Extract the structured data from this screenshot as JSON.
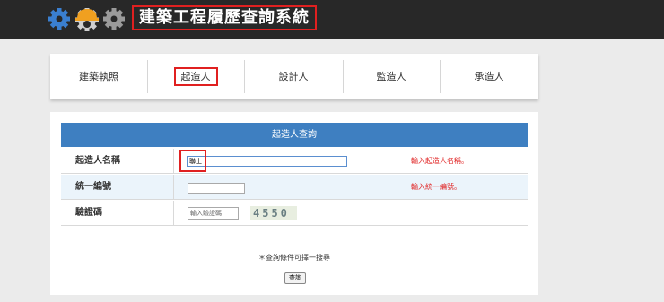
{
  "header": {
    "title": "建築工程履歷查詢系統",
    "logo_icons": [
      "gear-icon",
      "hardhat-gear-icon",
      "gear-icon"
    ]
  },
  "tabs": [
    {
      "label": "建築執照",
      "active": false
    },
    {
      "label": "起造人",
      "active": true
    },
    {
      "label": "設計人",
      "active": false
    },
    {
      "label": "監造人",
      "active": false
    },
    {
      "label": "承造人",
      "active": false
    }
  ],
  "panel": {
    "title": "起造人查詢",
    "rows": [
      {
        "label": "起造人名稱",
        "value": "聯上",
        "hint": "輸入起造人名稱。"
      },
      {
        "label": "統一編號",
        "value": "",
        "hint": "輸入統一編號。"
      },
      {
        "label": "驗證碼",
        "placeholder": "輸入驗證碼",
        "captcha": "4550"
      }
    ],
    "note": "＊查詢條件可擇一搜尋",
    "submit_label": "查詢"
  },
  "colors": {
    "header_bg": "#282828",
    "panel_header_bg": "#3e7fc1",
    "highlight": "#e02020",
    "hint_text": "#e02020",
    "gear_blue": "#3a7fd0",
    "hat_orange": "#f0a020",
    "gear_gray": "#9a9a9a"
  }
}
